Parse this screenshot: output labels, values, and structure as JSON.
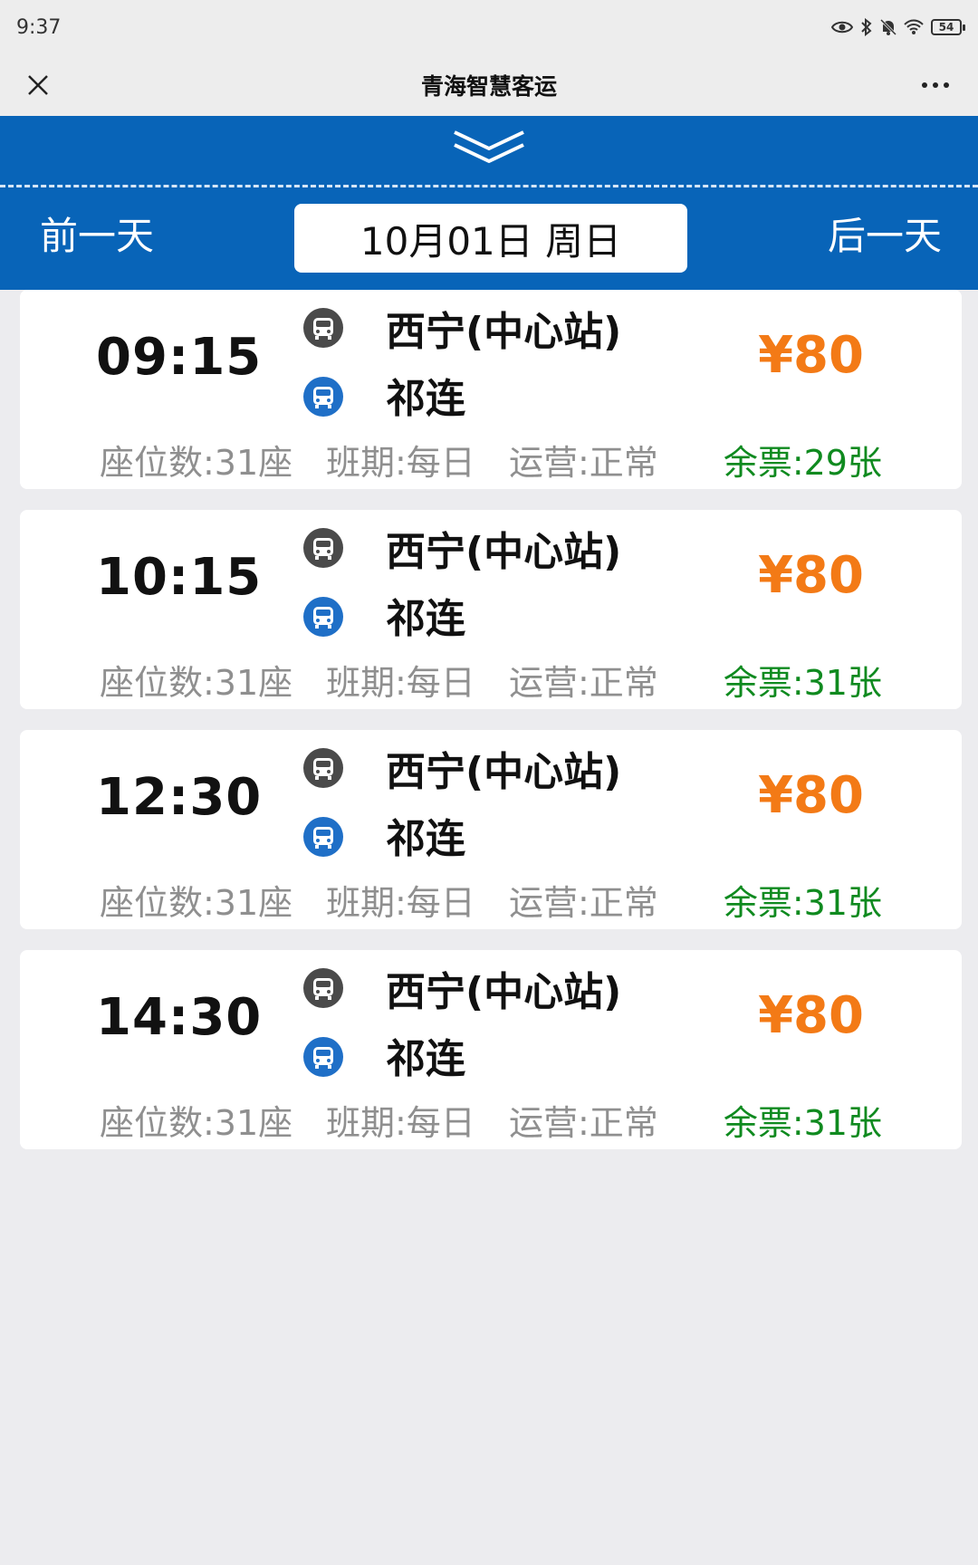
{
  "status_bar": {
    "time": "9:37",
    "battery": "54",
    "icons": [
      "eye-icon",
      "bluetooth-icon",
      "mute-icon",
      "wifi-icon",
      "battery-icon"
    ]
  },
  "title_bar": {
    "title": "青海智慧客运",
    "close_icon": "close-icon",
    "more_icon": "more-icon"
  },
  "date_nav": {
    "prev_label": "前一天",
    "date_label": "10月01日 周日",
    "next_label": "后一天",
    "expand_icon": "chevron-double-down-icon"
  },
  "colors": {
    "header_blue": "#0864b8",
    "price_orange": "#f37a16",
    "remaining_green": "#0f8a1f",
    "meta_gray": "#8f8f8f"
  },
  "trips": [
    {
      "time": "09:15",
      "from": "西宁(中心站)",
      "to": "祁连",
      "price": "¥80",
      "seats": "座位数:31座",
      "schedule": "班期:每日",
      "status": "运营:正常",
      "remaining": "余票:29张"
    },
    {
      "time": "10:15",
      "from": "西宁(中心站)",
      "to": "祁连",
      "price": "¥80",
      "seats": "座位数:31座",
      "schedule": "班期:每日",
      "status": "运营:正常",
      "remaining": "余票:31张"
    },
    {
      "time": "12:30",
      "from": "西宁(中心站)",
      "to": "祁连",
      "price": "¥80",
      "seats": "座位数:31座",
      "schedule": "班期:每日",
      "status": "运营:正常",
      "remaining": "余票:31张"
    },
    {
      "time": "14:30",
      "from": "西宁(中心站)",
      "to": "祁连",
      "price": "¥80",
      "seats": "座位数:31座",
      "schedule": "班期:每日",
      "status": "运营:正常",
      "remaining": "余票:31张"
    }
  ]
}
